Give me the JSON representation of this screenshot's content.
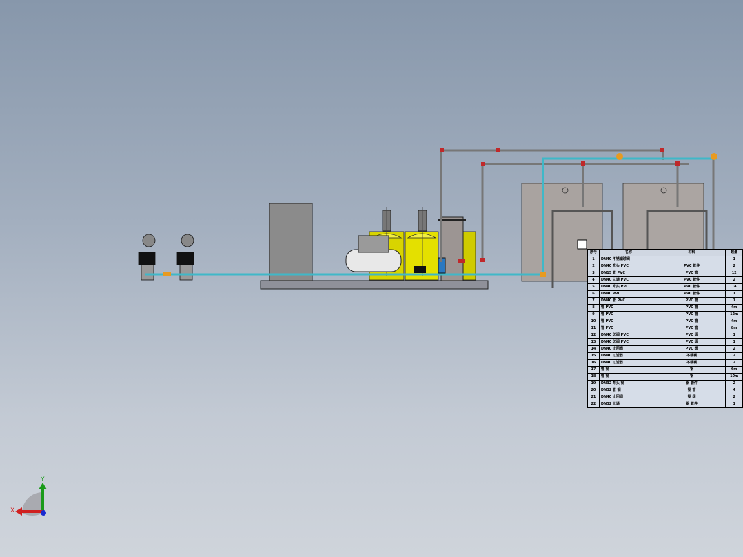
{
  "bom": {
    "headers": [
      "序号",
      "名称",
      "材料",
      "数量"
    ],
    "rows": [
      [
        "1",
        "DN40 不锈钢球阀",
        "",
        "1"
      ],
      [
        "2",
        "DN40 弯头 PVC",
        "PVC 管件",
        "2"
      ],
      [
        "3",
        "DN15 管 PVC",
        "PVC 管",
        "12"
      ],
      [
        "4",
        "DN40 三通 PVC",
        "PVC 管件",
        "2"
      ],
      [
        "5",
        "DN40 弯头 PVC",
        "PVC 管件",
        "14"
      ],
      [
        "6",
        "DN40 PVC",
        "PVC 管件",
        "1"
      ],
      [
        "7",
        "DN40 管 PVC",
        "PVC 管",
        "1"
      ],
      [
        "8",
        "管 PVC",
        "PVC 管",
        "4m"
      ],
      [
        "9",
        "管 PVC",
        "PVC 管",
        "12m"
      ],
      [
        "10",
        "管 PVC",
        "PVC 管",
        "4m"
      ],
      [
        "11",
        "管 PVC",
        "PVC 管",
        "8m"
      ],
      [
        "12",
        "DN40 球阀 PVC",
        "PVC 阀",
        "1"
      ],
      [
        "13",
        "DN40 球阀 PVC",
        "PVC 阀",
        "1"
      ],
      [
        "14",
        "DN40 止回阀",
        "PVC 阀",
        "2"
      ],
      [
        "15",
        "DN40 过滤器",
        "不锈钢",
        "2"
      ],
      [
        "16",
        "DN40 过滤器",
        "不锈钢",
        "2"
      ],
      [
        "17",
        "管 钢",
        "钢",
        "6m"
      ],
      [
        "18",
        "管 钢",
        "钢",
        "10m"
      ],
      [
        "19",
        "DN32 弯头 钢",
        "钢 管件",
        "2"
      ],
      [
        "20",
        "DN32 管 钢",
        "钢 管",
        "4"
      ],
      [
        "21",
        "DN40 止回阀",
        "钢 阀",
        "2"
      ],
      [
        "22",
        "DN32 三通",
        "钢 管件",
        "1"
      ]
    ]
  },
  "triad": {
    "x_label": "X",
    "y_label": "Y"
  },
  "colors": {
    "pipe_cyan": "#3fb8c8",
    "tank_yellow": "#dcd800",
    "valve_red": "#c0282a",
    "fitting_orange": "#e89a20"
  }
}
